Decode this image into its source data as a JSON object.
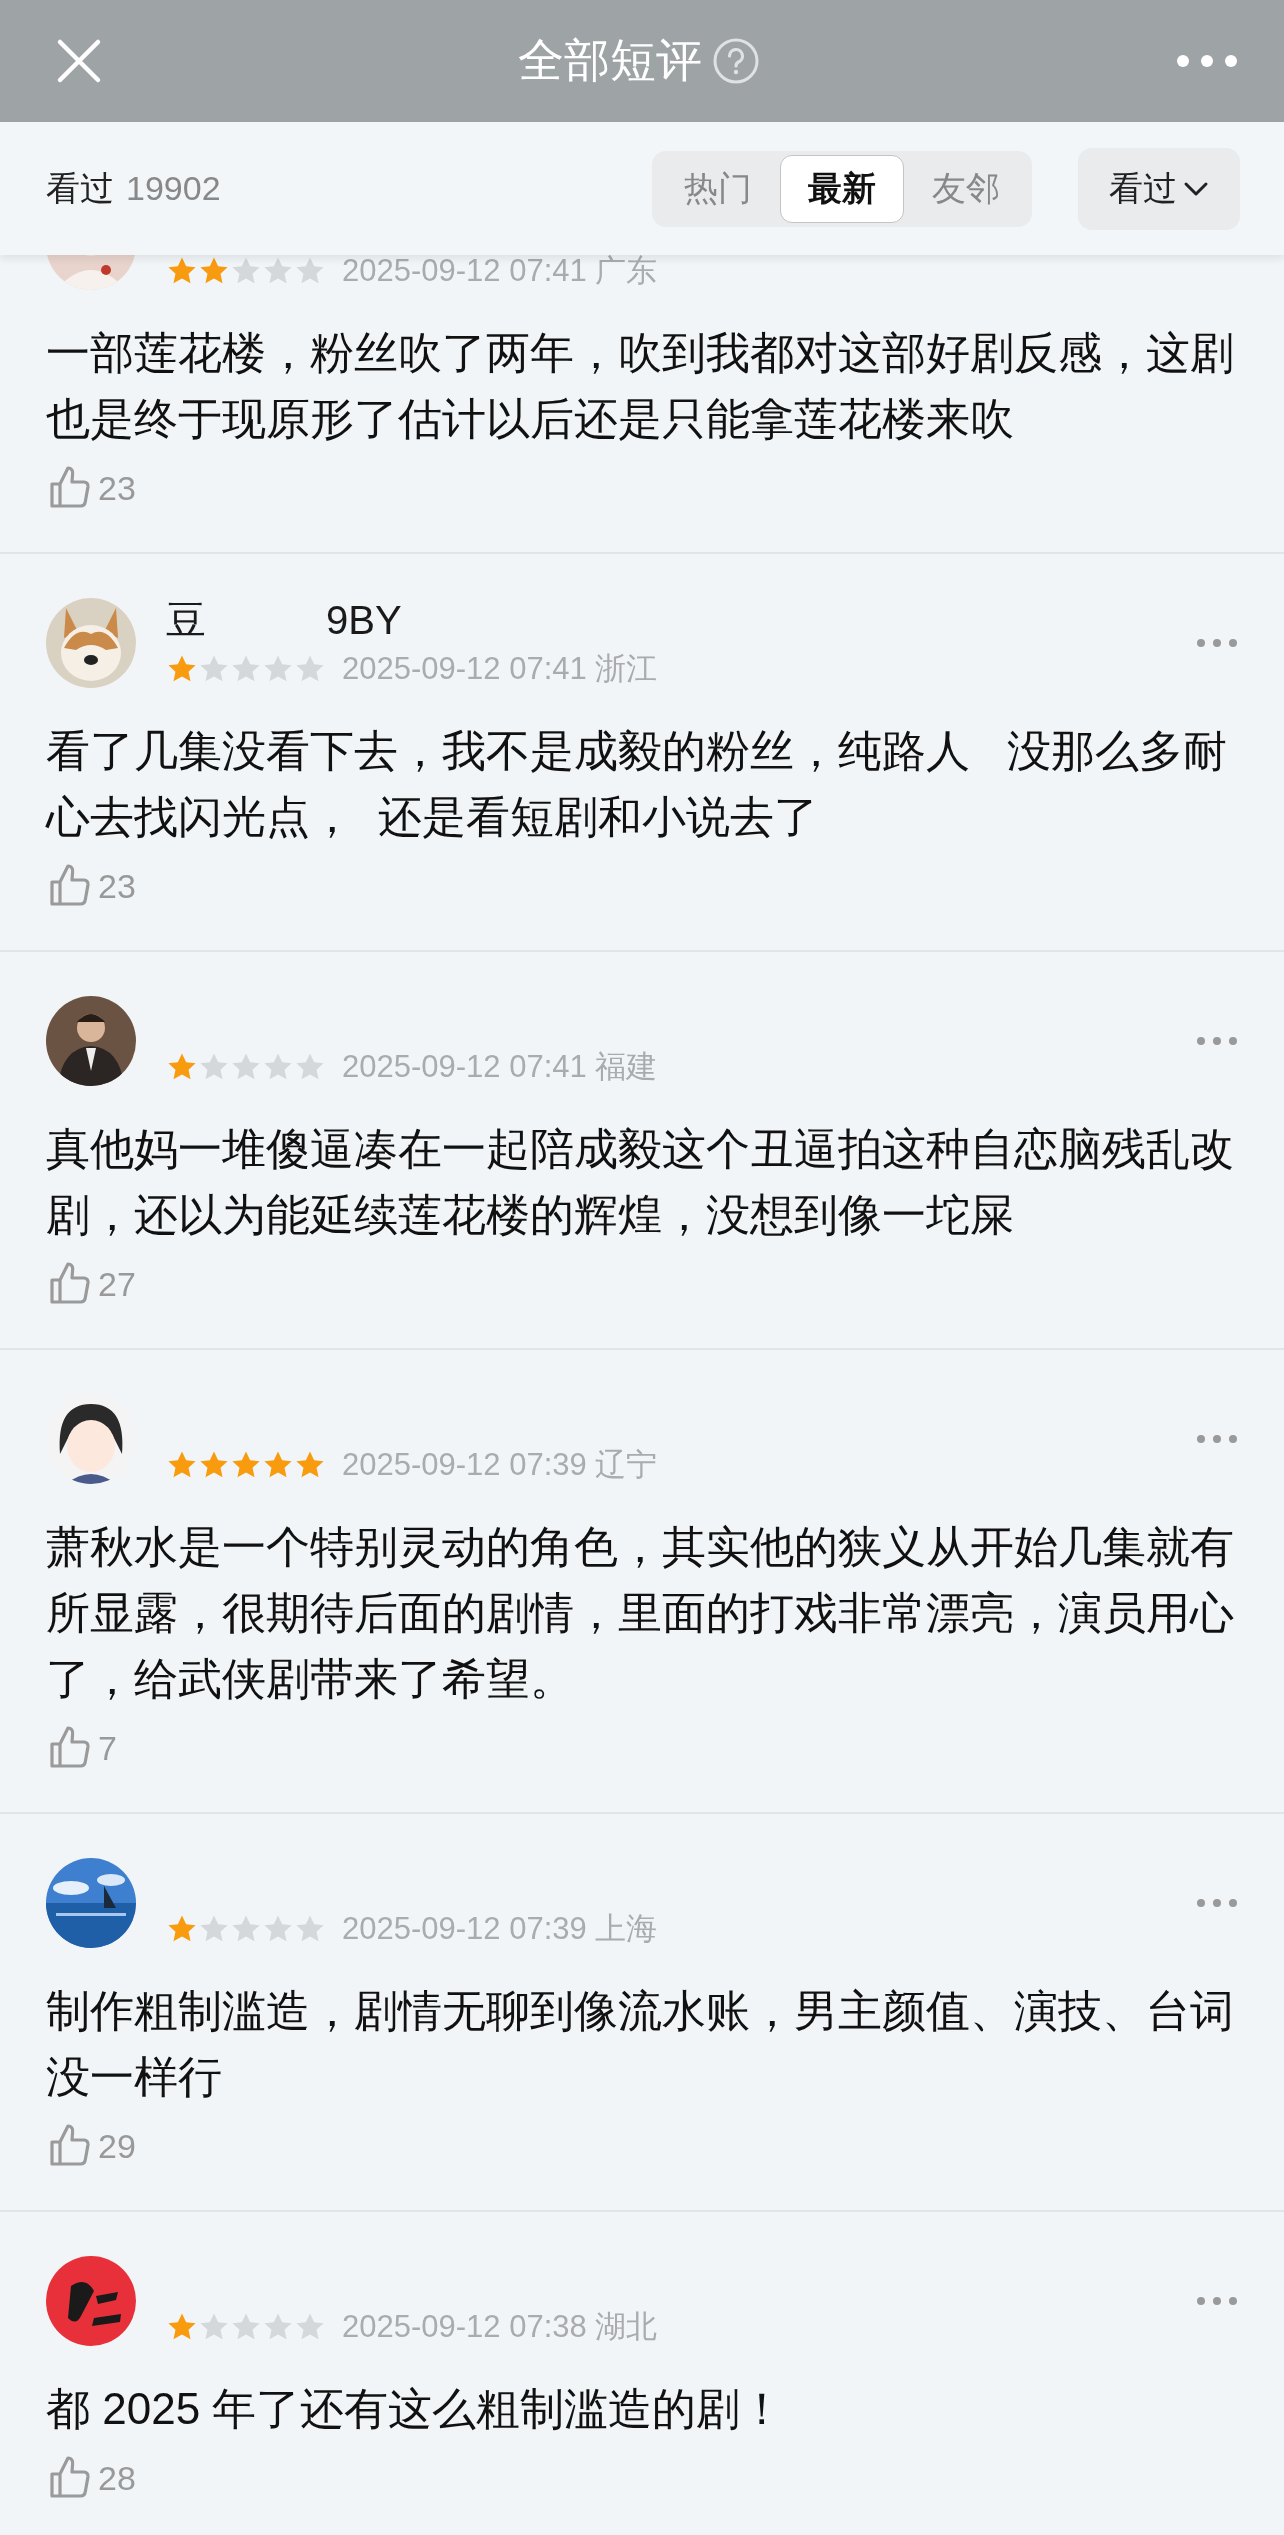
{
  "header": {
    "title": "全部短评"
  },
  "filter_bar": {
    "label": "看过",
    "count": "19902",
    "tabs": [
      {
        "label": "热门",
        "selected": false
      },
      {
        "label": "最新",
        "selected": true
      },
      {
        "label": "友邻",
        "selected": false
      }
    ],
    "dropdown": "看过"
  },
  "reviews": [
    {
      "stars": 2,
      "time": "2025-09-12 07:41",
      "location": "广东",
      "text": "一部莲花楼，粉丝吹了两年，吹到我都对这部好剧反感，这剧也是终于现原形了估计以后还是只能拿莲花楼来吹",
      "likes": "23",
      "clipped": true
    },
    {
      "name_parts": [
        "豆",
        "9BY"
      ],
      "stars": 1,
      "time": "2025-09-12 07:41",
      "location": "浙江",
      "text": "看了几集没看下去，我不是成毅的粉丝，纯路人   没那么多耐心去找闪光点，  还是看短剧和小说去了",
      "likes": "23",
      "clipped": false
    },
    {
      "stars": 1,
      "time": "2025-09-12 07:41",
      "location": "福建",
      "text": "真他妈一堆傻逼凑在一起陪成毅这个丑逼拍这种自恋脑残乱改剧，还以为能延续莲花楼的辉煌，没想到像一坨屎",
      "likes": "27",
      "clipped": false
    },
    {
      "stars": 5,
      "time": "2025-09-12 07:39",
      "location": "辽宁",
      "text": "萧秋水是一个特别灵动的角色，其实他的狭义从开始几集就有所显露，很期待后面的剧情，里面的打戏非常漂亮，演员用心了，给武侠剧带来了希望。",
      "likes": "7",
      "clipped": false
    },
    {
      "stars": 1,
      "time": "2025-09-12 07:39",
      "location": "上海",
      "text": "制作粗制滥造，剧情无聊到像流水账，男主颜值、演技、台词没一样行",
      "likes": "29",
      "clipped": false
    },
    {
      "stars": 1,
      "time": "2025-09-12 07:38",
      "location": "湖北",
      "text": "都 2025 年了还有这么粗制滥造的剧！",
      "likes": "28",
      "clipped": false
    }
  ]
}
